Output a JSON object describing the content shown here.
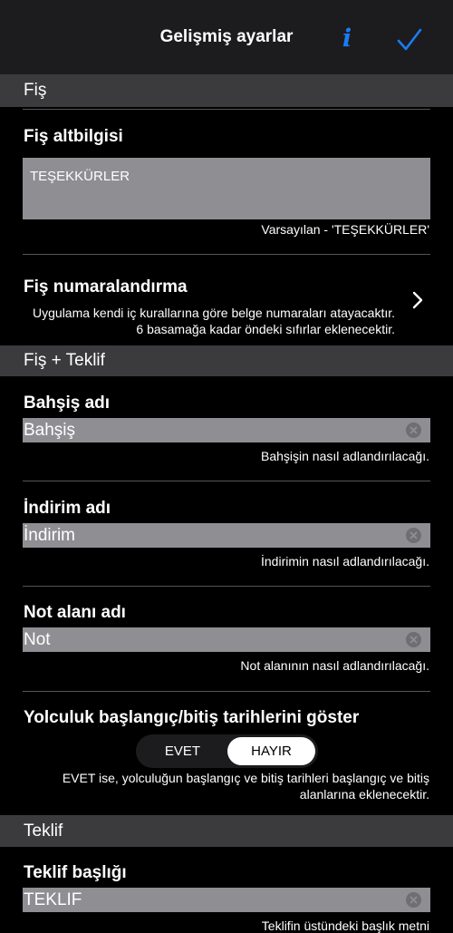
{
  "navbar": {
    "title": "Gelişmiş ayarlar",
    "info_label": "i"
  },
  "sections": {
    "fis": "Fiş",
    "fis_teklif": "Fiş + Teklif",
    "teklif": "Teklif"
  },
  "fis_altbilgisi": {
    "title": "Fiş altbilgisi",
    "value": "TEŞEKKÜRLER",
    "hint": "Varsayılan - 'TEŞEKKÜRLER'"
  },
  "fis_numaralandirma": {
    "title": "Fiş numaralandırma",
    "description": "Uygulama kendi iç kurallarına göre belge numaraları atayacaktır. 6 basamağa kadar öndeki sıfırlar eklenecektir."
  },
  "bahsis": {
    "title": "Bahşiş adı",
    "value": "Bahşiş",
    "hint": "Bahşişin nasıl adlandırılacağı."
  },
  "indirim": {
    "title": "İndirim adı",
    "value": "İndirim",
    "hint": "İndirimin nasıl adlandırılacağı."
  },
  "not_alani": {
    "title": "Not alanı adı",
    "value": "Not",
    "hint": "Not alanının nasıl adlandırılacağı."
  },
  "yolculuk": {
    "title": "Yolculuk başlangıç/bitiş tarihlerini göster",
    "option_yes": "EVET",
    "option_no": "HAYIR",
    "selected": "HAYIR",
    "description": "EVET ise, yolculuğun başlangıç ve bitiş tarihleri başlangıç ve bitiş alanlarına eklenecektir."
  },
  "teklif_basligi": {
    "title": "Teklif başlığı",
    "value": "TEKLIF",
    "hint": "Teklifin üstündeki başlık metni"
  },
  "colors": {
    "accent": "#1a7cf5",
    "navbar_bg": "#1c1c1e",
    "section_bg": "#3b3b3d",
    "input_bg": "#8e8e93"
  }
}
